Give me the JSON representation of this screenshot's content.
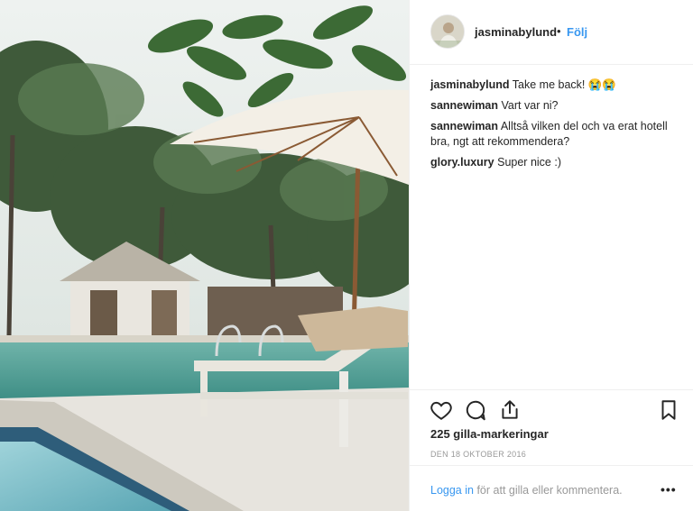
{
  "post": {
    "username": "jasminabylund",
    "separator": "•",
    "follow_label": "Följ"
  },
  "comments": [
    {
      "user": "jasminabylund",
      "text": "Take me back! 😭😭"
    },
    {
      "user": "sannewiman",
      "text": "Vart var ni?"
    },
    {
      "user": "sannewiman",
      "text": "Alltså vilken del och va erat hotell bra, ngt att rekommendera?"
    },
    {
      "user": "glory.luxury",
      "text": "Super nice :)"
    }
  ],
  "actions": {
    "icons": [
      "heart-icon",
      "comment-icon",
      "share-icon",
      "bookmark-icon"
    ]
  },
  "likes_label": "225 gilla-markeringar",
  "date_label": "DEN 18 OKTOBER 2016",
  "footer": {
    "login_link": "Logga in",
    "login_rest": "för att gilla eller kommentera.",
    "more_label": "•••"
  },
  "colors": {
    "link_blue": "#3897f0",
    "text_dark": "#262626",
    "muted": "#999999",
    "divider": "#efefef"
  }
}
